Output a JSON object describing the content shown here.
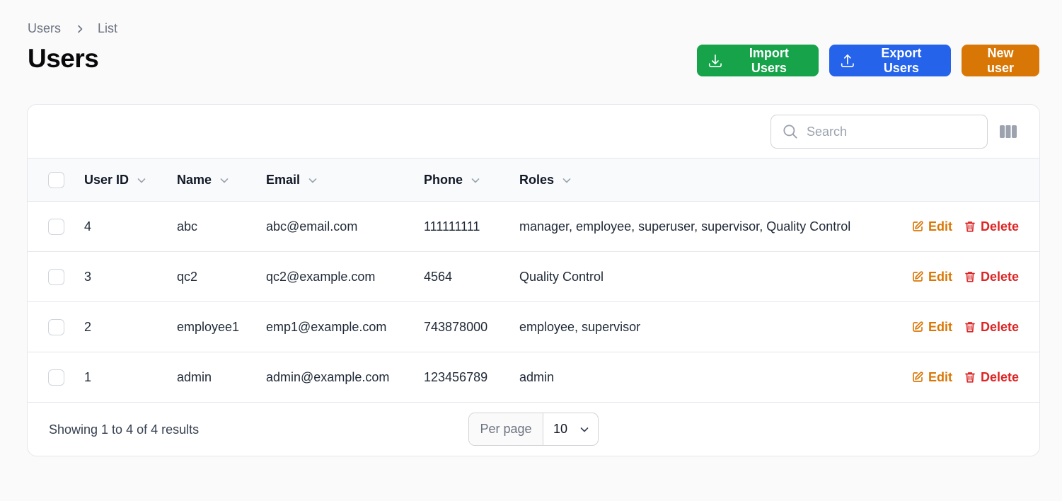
{
  "breadcrumb": {
    "parent": "Users",
    "current": "List"
  },
  "page_title": "Users",
  "actions": {
    "import_label": "Import Users",
    "export_label": "Export Users",
    "new_label": "New user"
  },
  "colors": {
    "import": "#16a34a",
    "export": "#2563eb",
    "new": "#d97706",
    "edit": "#d97706",
    "delete": "#dc2626"
  },
  "search": {
    "placeholder": "Search",
    "value": ""
  },
  "table": {
    "columns": [
      "User ID",
      "Name",
      "Email",
      "Phone",
      "Roles"
    ],
    "rows": [
      {
        "id": "4",
        "name": "abc",
        "email": "abc@email.com",
        "phone": "111111111",
        "roles": "manager, employee, superuser, supervisor, Quality Control"
      },
      {
        "id": "3",
        "name": "qc2",
        "email": "qc2@example.com",
        "phone": "4564",
        "roles": "Quality Control"
      },
      {
        "id": "2",
        "name": "employee1",
        "email": "emp1@example.com",
        "phone": "743878000",
        "roles": "employee, supervisor"
      },
      {
        "id": "1",
        "name": "admin",
        "email": "admin@example.com",
        "phone": "123456789",
        "roles": "admin"
      }
    ],
    "edit_label": "Edit",
    "delete_label": "Delete"
  },
  "footer": {
    "results_text": "Showing 1 to 4 of 4 results",
    "per_page_label": "Per page",
    "per_page_value": "10"
  },
  "icons": {
    "import": "download-icon",
    "export": "upload-icon",
    "search": "search-icon",
    "columns": "columns-icon",
    "sort": "chevron-down-icon",
    "edit": "pencil-square-icon",
    "delete": "trash-icon"
  }
}
